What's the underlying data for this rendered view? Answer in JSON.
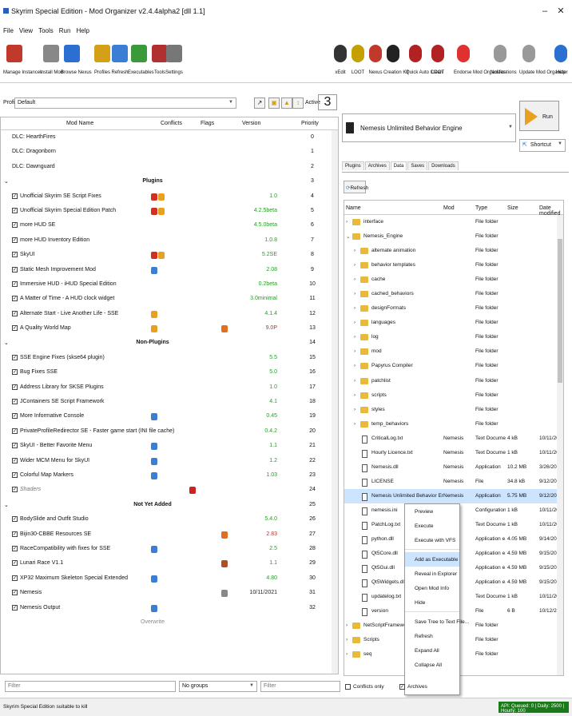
{
  "window": {
    "title": "Skyrim Special Edition - Mod Organizer v2.4.4alpha2 [dll 1.1]"
  },
  "menu": [
    "File",
    "View",
    "Tools",
    "Run",
    "Help"
  ],
  "toolbar_left": [
    {
      "label": "Manage Instances",
      "icon": "instances-icon",
      "color": "#c0392b"
    },
    {
      "label": "Install Mod",
      "icon": "install-icon",
      "color": "#888888"
    },
    {
      "label": "Browse Nexus",
      "icon": "nexus-icon",
      "color": "#2a6fd1"
    },
    {
      "label": "Profiles",
      "icon": "profiles-icon",
      "color": "#d4a017"
    },
    {
      "label": "Refresh",
      "icon": "refresh-icon",
      "color": "#3a7fd5"
    },
    {
      "label": "Executables",
      "icon": "executables-icon",
      "color": "#3a9a3a"
    },
    {
      "label": "Tools",
      "icon": "tools-icon",
      "color": "#b03030"
    },
    {
      "label": "Settings",
      "icon": "settings-icon",
      "color": "#777777"
    }
  ],
  "toolbar_right": [
    {
      "label": "xEdit",
      "icon": "xedit-icon",
      "color": "#333333"
    },
    {
      "label": "LOOT",
      "icon": "loot-icon",
      "color": "#c4a000"
    },
    {
      "label": "Nexus",
      "icon": "nexus-icon",
      "color": "#c0392b"
    },
    {
      "label": "Creation Kit",
      "icon": "creationkit-icon",
      "color": "#222222"
    },
    {
      "label": "Quick Auto Clean",
      "icon": "autoclean-icon",
      "color": "#b22222"
    },
    {
      "label": "LOOT",
      "icon": "loot-icon",
      "color": "#b22222"
    },
    {
      "label": "Endorse Mod Organizer",
      "icon": "heart-icon",
      "color": "#e03030"
    },
    {
      "label": "Notifications",
      "icon": "warning-icon",
      "color": "#999999"
    },
    {
      "label": "Update Mod Organizer",
      "icon": "update-icon",
      "color": "#999999"
    },
    {
      "label": "Help",
      "icon": "help-icon",
      "color": "#2a6fd1"
    }
  ],
  "profile": {
    "label": "Profile",
    "value": "Default",
    "active_label": "Active",
    "active_count": "3"
  },
  "modlist": {
    "headers": {
      "name": "Mod Name",
      "conflicts": "Conflicts",
      "flags": "Flags",
      "version": "Version",
      "priority": "Priority"
    },
    "rows": [
      {
        "type": "mod",
        "check": "",
        "name": "DLC: HearthFires",
        "version": "",
        "vcolor": "black",
        "priority": "0",
        "icons": []
      },
      {
        "type": "mod",
        "check": "",
        "name": "DLC: Dragonborn",
        "version": "",
        "vcolor": "black",
        "priority": "1",
        "icons": []
      },
      {
        "type": "mod",
        "check": "",
        "name": "DLC: Dawnguard",
        "version": "",
        "vcolor": "black",
        "priority": "2",
        "icons": []
      },
      {
        "type": "sep",
        "name": "Plugins",
        "priority": "3"
      },
      {
        "type": "mod",
        "check": "✓",
        "name": "Unofficial Skyrim SE Script Fixes",
        "version": "1.0",
        "vcolor": "green",
        "priority": "4",
        "icons": [
          "#d03020",
          "#e8a020"
        ]
      },
      {
        "type": "mod",
        "check": "✓",
        "name": "Unofficial Skyrim Special Edition Patch",
        "version": "4.2.5beta",
        "vcolor": "green",
        "priority": "5",
        "icons": [
          "#d03020",
          "#e8a020"
        ]
      },
      {
        "type": "mod",
        "check": "✓",
        "name": "more HUD SE",
        "version": "4.5.0beta",
        "vcolor": "green",
        "priority": "6",
        "icons": []
      },
      {
        "type": "mod",
        "check": "✓",
        "name": "more HUD Inventory Edition",
        "version": "1.0.8",
        "vcolor": "green",
        "priority": "7",
        "icons": []
      },
      {
        "type": "mod",
        "check": "✓",
        "name": "SkyUI",
        "version": "5.2SE",
        "vcolor": "green",
        "priority": "8",
        "icons": [
          "#d03020",
          "#e8a020"
        ]
      },
      {
        "type": "mod",
        "check": "✓",
        "name": "Static Mesh Improvement Mod",
        "version": "2.08",
        "vcolor": "green",
        "priority": "9",
        "icons": [
          "#3a7fd5"
        ]
      },
      {
        "type": "mod",
        "check": "✓",
        "name": "Immersive HUD - iHUD Special Edition",
        "version": "0.2beta",
        "vcolor": "green",
        "priority": "10",
        "icons": []
      },
      {
        "type": "mod",
        "check": "✓",
        "name": "A Matter of Time - A HUD clock widget",
        "version": "3.0minimal",
        "vcolor": "green",
        "priority": "11",
        "icons": []
      },
      {
        "type": "mod",
        "check": "✓",
        "name": "Alternate Start - Live Another Life - SSE",
        "version": "4.1.4",
        "vcolor": "green",
        "priority": "12",
        "icons": [
          "#e8a020"
        ]
      },
      {
        "type": "mod",
        "check": "✓",
        "name": "A Quality World Map",
        "version": "9.0P",
        "vcolor": "red",
        "priority": "13",
        "icons": [
          "#e8a020"
        ],
        "flag": "#e07020"
      },
      {
        "type": "sep",
        "name": "Non-Plugins",
        "priority": "14"
      },
      {
        "type": "mod",
        "check": "✓",
        "name": "SSE Engine Fixes (skse64 plugin)",
        "version": "5.5",
        "vcolor": "green",
        "priority": "15",
        "icons": []
      },
      {
        "type": "mod",
        "check": "✓",
        "name": "Bug Fixes SSE",
        "version": "5.0",
        "vcolor": "green",
        "priority": "16",
        "icons": []
      },
      {
        "type": "mod",
        "check": "✓",
        "name": "Address Library for SKSE Plugins",
        "version": "1.0",
        "vcolor": "green",
        "priority": "17",
        "icons": []
      },
      {
        "type": "mod",
        "check": "✓",
        "name": "JContainers SE Script Framework",
        "version": "4.1",
        "vcolor": "green",
        "priority": "18",
        "icons": []
      },
      {
        "type": "mod",
        "check": "✓",
        "name": "More Informative Console",
        "version": "0.45",
        "vcolor": "green",
        "priority": "19",
        "icons": [
          "#3a7fd5"
        ]
      },
      {
        "type": "mod",
        "check": "✓",
        "name": "PrivateProfileRedirector SE - Faster game start (INI file cache)",
        "version": "0.4.2",
        "vcolor": "green",
        "priority": "20",
        "icons": []
      },
      {
        "type": "mod",
        "check": "✓",
        "name": "SkyUI - Better Favorite Menu",
        "version": "1.1",
        "vcolor": "green",
        "priority": "21",
        "icons": [
          "#3a7fd5"
        ]
      },
      {
        "type": "mod",
        "check": "✓",
        "name": "Wider MCM Menu for SkyUI",
        "version": "1.2",
        "vcolor": "green",
        "priority": "22",
        "icons": [
          "#3a7fd5"
        ]
      },
      {
        "type": "mod",
        "check": "✓",
        "name": "Colorful Map Markers",
        "version": "1.03",
        "vcolor": "green",
        "priority": "23",
        "icons": [
          "#3a7fd5"
        ]
      },
      {
        "type": "mod",
        "check": "✓",
        "name": "Shaders",
        "version": "",
        "vcolor": "black",
        "priority": "24",
        "icons": [],
        "italic": true,
        "flag": "#d02020"
      },
      {
        "type": "sep",
        "name": "Not Yet Added",
        "priority": "25"
      },
      {
        "type": "mod",
        "check": "✓",
        "name": "BodySlide and Outfit Studio",
        "version": "5.4.0",
        "vcolor": "green",
        "priority": "26",
        "icons": []
      },
      {
        "type": "mod",
        "check": "✓",
        "name": "Bijin30-CBBE Resources SE",
        "version": "2.83",
        "vcolor": "red",
        "priority": "27",
        "icons": [],
        "flag": "#e07020"
      },
      {
        "type": "mod",
        "check": "✓",
        "name": "RaceCompatibility with fixes for SSE",
        "version": "2.5",
        "vcolor": "green",
        "priority": "28",
        "icons": [
          "#3a7fd5"
        ]
      },
      {
        "type": "mod",
        "check": "✓",
        "name": "Lunari Race V1.1",
        "version": "1.1",
        "vcolor": "green",
        "priority": "29",
        "icons": [],
        "flag": "#b05020"
      },
      {
        "type": "mod",
        "check": "✓",
        "name": "XP32 Maximum Skeleton Special Extended",
        "version": "4.80",
        "vcolor": "green",
        "priority": "30",
        "icons": [
          "#3a7fd5"
        ]
      },
      {
        "type": "mod",
        "check": "✓",
        "name": "Nemesis",
        "version": "10/11/2021",
        "vcolor": "black",
        "priority": "31",
        "icons": [],
        "flag": "#888888"
      },
      {
        "type": "mod",
        "check": "✓",
        "name": "Nemesis Output",
        "version": "",
        "vcolor": "black",
        "priority": "32",
        "icons": [
          "#3a7fd5"
        ]
      },
      {
        "type": "sep",
        "name": "Overwrite",
        "priority": ""
      }
    ]
  },
  "right": {
    "executable": "Nemesis Unlimited Behavior Engine",
    "run_label": "Run",
    "shortcut_label": "Shortcut",
    "tabs": [
      "Plugins",
      "Archives",
      "Data",
      "Saves",
      "Downloads"
    ],
    "active_tab": "Data",
    "refresh_label": "Refresh",
    "data_headers": {
      "name": "Name",
      "mod": "Mod",
      "type": "Type",
      "size": "Size",
      "date": "Date modified"
    },
    "data_rows": [
      {
        "indent": 0,
        "kind": "folder",
        "arrow": "›",
        "name": "interface",
        "mod": "",
        "type": "File folder",
        "size": "",
        "date": ""
      },
      {
        "indent": 0,
        "kind": "folder",
        "arrow": "⌄",
        "name": "Nemesis_Engine",
        "mod": "",
        "type": "File folder",
        "size": "",
        "date": ""
      },
      {
        "indent": 1,
        "kind": "folder",
        "arrow": "›",
        "name": "alternate animation",
        "mod": "",
        "type": "File folder",
        "size": "",
        "date": ""
      },
      {
        "indent": 1,
        "kind": "folder",
        "arrow": "›",
        "name": "behavior templates",
        "mod": "",
        "type": "File folder",
        "size": "",
        "date": ""
      },
      {
        "indent": 1,
        "kind": "folder",
        "arrow": "›",
        "name": "cache",
        "mod": "",
        "type": "File folder",
        "size": "",
        "date": ""
      },
      {
        "indent": 1,
        "kind": "folder",
        "arrow": "›",
        "name": "cached_behaviors",
        "mod": "",
        "type": "File folder",
        "size": "",
        "date": ""
      },
      {
        "indent": 1,
        "kind": "folder",
        "arrow": "›",
        "name": "designFormats",
        "mod": "",
        "type": "File folder",
        "size": "",
        "date": ""
      },
      {
        "indent": 1,
        "kind": "folder",
        "arrow": "›",
        "name": "languages",
        "mod": "",
        "type": "File folder",
        "size": "",
        "date": ""
      },
      {
        "indent": 1,
        "kind": "folder",
        "arrow": "›",
        "name": "log",
        "mod": "",
        "type": "File folder",
        "size": "",
        "date": ""
      },
      {
        "indent": 1,
        "kind": "folder",
        "arrow": "›",
        "name": "mod",
        "mod": "",
        "type": "File folder",
        "size": "",
        "date": ""
      },
      {
        "indent": 1,
        "kind": "folder",
        "arrow": "›",
        "name": "Papyrus Compiler",
        "mod": "",
        "type": "File folder",
        "size": "",
        "date": ""
      },
      {
        "indent": 1,
        "kind": "folder",
        "arrow": "›",
        "name": "patchlist",
        "mod": "",
        "type": "File folder",
        "size": "",
        "date": ""
      },
      {
        "indent": 1,
        "kind": "folder",
        "arrow": "›",
        "name": "scripts",
        "mod": "",
        "type": "File folder",
        "size": "",
        "date": ""
      },
      {
        "indent": 1,
        "kind": "folder",
        "arrow": "›",
        "name": "styles",
        "mod": "",
        "type": "File folder",
        "size": "",
        "date": ""
      },
      {
        "indent": 1,
        "kind": "folder",
        "arrow": "›",
        "name": "temp_behaviors",
        "mod": "",
        "type": "File folder",
        "size": "",
        "date": ""
      },
      {
        "indent": 1,
        "kind": "file",
        "arrow": "",
        "name": "CriticalLog.txt",
        "mod": "Nemesis",
        "type": "Text Document",
        "size": "4 kB",
        "date": "10/11/2021"
      },
      {
        "indent": 1,
        "kind": "file",
        "arrow": "",
        "name": "Hourly Licence.txt",
        "mod": "Nemesis",
        "type": "Text Document",
        "size": "1 kB",
        "date": "10/11/2021"
      },
      {
        "indent": 1,
        "kind": "file",
        "arrow": "",
        "name": "Nemesis.dll",
        "mod": "Nemesis",
        "type": "Application",
        "size": "10.2 MB",
        "date": "3/26/2021"
      },
      {
        "indent": 1,
        "kind": "file",
        "arrow": "",
        "name": "LICENSE",
        "mod": "Nemesis",
        "type": "File",
        "size": "34.8 kB",
        "date": "9/12/2021"
      },
      {
        "indent": 1,
        "kind": "file",
        "arrow": "",
        "name": "Nemesis Unlimited Behavior Engine.exe",
        "mod": "Nemesis",
        "type": "Application",
        "size": "5.75 MB",
        "date": "9/12/2021",
        "sel": true
      },
      {
        "indent": 1,
        "kind": "file",
        "arrow": "",
        "name": "nemesis.ini",
        "mod": "",
        "type": "Configuration s...",
        "size": "1 kB",
        "date": "10/11/2021"
      },
      {
        "indent": 1,
        "kind": "file",
        "arrow": "",
        "name": "PatchLog.txt",
        "mod": "",
        "type": "Text Document",
        "size": "1 kB",
        "date": "10/11/2021"
      },
      {
        "indent": 1,
        "kind": "file",
        "arrow": "",
        "name": "python.dll",
        "mod": "",
        "type": "Application e...",
        "size": "4.05 MB",
        "date": "9/14/2021"
      },
      {
        "indent": 1,
        "kind": "file",
        "arrow": "",
        "name": "Qt5Core.dll",
        "mod": "",
        "type": "Application e...",
        "size": "4.59 MB",
        "date": "9/15/2021"
      },
      {
        "indent": 1,
        "kind": "file",
        "arrow": "",
        "name": "Qt5Gui.dll",
        "mod": "",
        "type": "Application e...",
        "size": "4.59 MB",
        "date": "9/15/2021"
      },
      {
        "indent": 1,
        "kind": "file",
        "arrow": "",
        "name": "Qt5Widgets.dll",
        "mod": "",
        "type": "Application e...",
        "size": "4.59 MB",
        "date": "9/15/2021"
      },
      {
        "indent": 1,
        "kind": "file",
        "arrow": "",
        "name": "updatelog.txt",
        "mod": "",
        "type": "Text Document",
        "size": "1 kB",
        "date": "10/11/2021"
      },
      {
        "indent": 1,
        "kind": "file",
        "arrow": "",
        "name": "version",
        "mod": "",
        "type": "File",
        "size": "6 B",
        "date": "10/12/2021"
      },
      {
        "indent": 0,
        "kind": "folder",
        "arrow": "›",
        "name": "NetScriptFramework",
        "mod": "",
        "type": "File folder",
        "size": "",
        "date": ""
      },
      {
        "indent": 0,
        "kind": "folder",
        "arrow": "›",
        "name": "Scripts",
        "mod": "",
        "type": "File folder",
        "size": "",
        "date": ""
      },
      {
        "indent": 0,
        "kind": "folder",
        "arrow": "›",
        "name": "seq",
        "mod": "",
        "type": "File folder",
        "size": "",
        "date": ""
      }
    ]
  },
  "context_menu": {
    "items": [
      "Preview",
      "Execute",
      "Execute with VFS",
      "sep",
      "Add as Executable",
      "Reveal in Explorer",
      "Open Mod Info",
      "Hide",
      "sep",
      "Save Tree to Text File...",
      "Refresh",
      "Expand All",
      "Collapse All"
    ],
    "highlighted": "Add as Executable"
  },
  "filters": {
    "filter_placeholder": "Filter",
    "group_value": "No groups",
    "filter2_placeholder": "Filter",
    "conflicts_label": "Conflicts only",
    "archives_label": "Archives"
  },
  "status": {
    "left": "Skyrim Special Edition suitable to kill",
    "right": "API: Queued: 0 | Daily: 2500 | Hourly: 100"
  }
}
